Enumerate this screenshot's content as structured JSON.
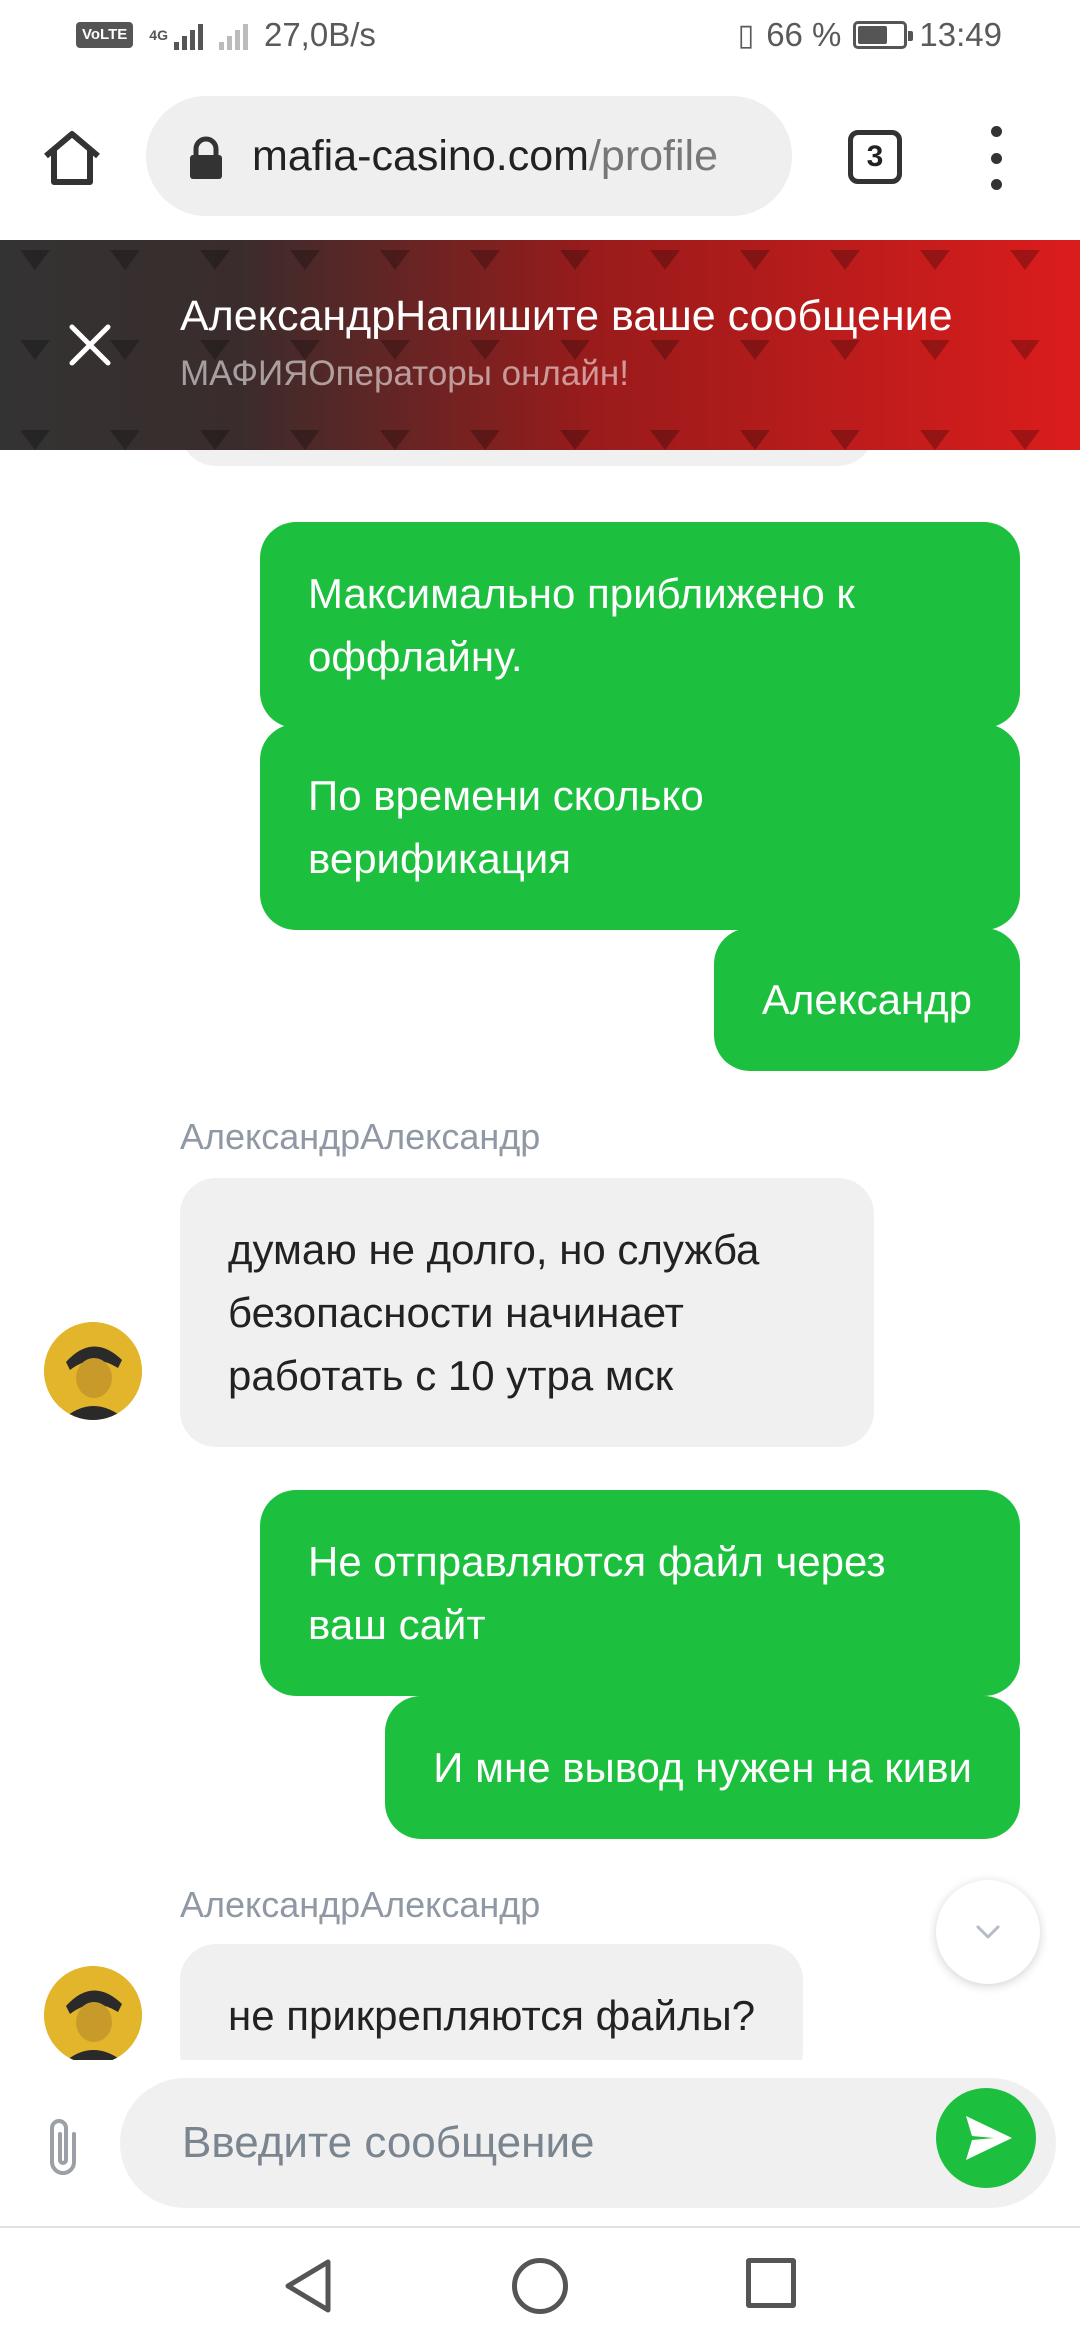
{
  "status_bar": {
    "volte": "VoLTE",
    "network": "4G",
    "speed": "27,0B/s",
    "battery_pct": "66 %",
    "battery_level": 0.66,
    "time": "13:49"
  },
  "browser": {
    "url_host": "mafia-casino.com",
    "url_path": "/profile",
    "tab_count": "3",
    "icons": [
      "home-icon",
      "lock-icon",
      "tabs-icon",
      "more-vert-icon"
    ]
  },
  "chat_header": {
    "title": "АлександрНапишите ваше сообщение",
    "subtitle": "МАФИЯОператоры онлайн!",
    "gradient_from": "#333333",
    "gradient_to": "#dc1c1c"
  },
  "messages": [
    {
      "direction": "out",
      "text": "Максимально приближено к оффлайну."
    },
    {
      "direction": "out",
      "text": "По времени сколько верификация"
    },
    {
      "direction": "out",
      "text": "Александр"
    },
    {
      "direction": "in",
      "sender": "АлександрАлександр",
      "text": "думаю не долго, но служба безопасности начинает работать с 10 утра мск"
    },
    {
      "direction": "out",
      "text": "Не отправляются файл через ваш сайт"
    },
    {
      "direction": "out",
      "text": "И мне вывод нужен на киви"
    },
    {
      "direction": "in",
      "sender": "АлександрАлександр",
      "text": "не прикрепляются файлы?"
    }
  ],
  "composer": {
    "placeholder": "Введите сообщение"
  },
  "colors": {
    "outgoing_bubble": "#1dbf3f",
    "incoming_bubble": "#f0f0f0",
    "sender_name": "#8f98a4"
  }
}
